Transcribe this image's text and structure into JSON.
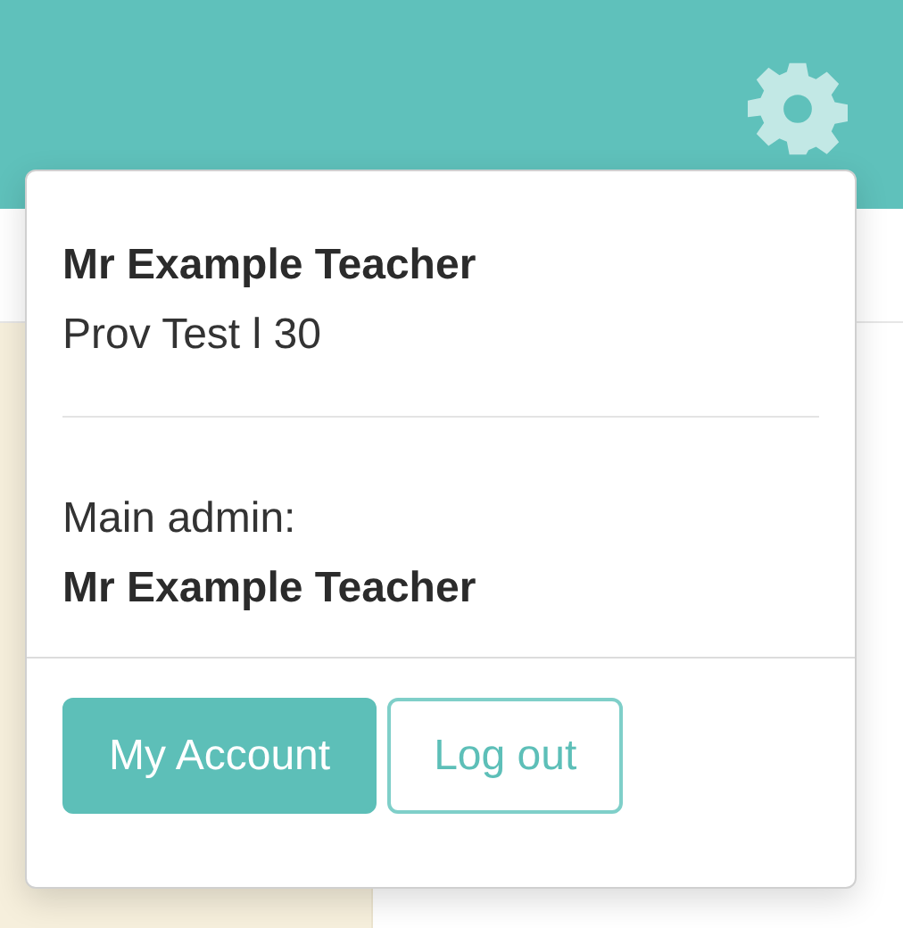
{
  "header": {
    "menu_open": true
  },
  "account_menu": {
    "name": "Mr Example Teacher",
    "subtitle": "Prov Test l 30",
    "admin_label": "Main admin:",
    "admin_name": "Mr Example Teacher",
    "buttons": [
      {
        "label": "My Account",
        "kind": "primary"
      },
      {
        "label": "Log out",
        "kind": "outline"
      }
    ]
  }
}
